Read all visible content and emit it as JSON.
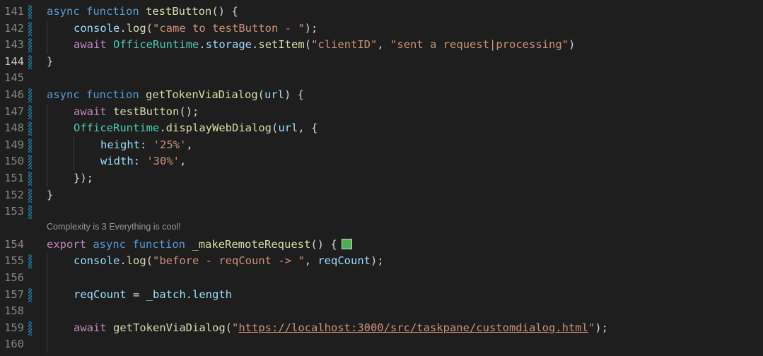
{
  "editor": {
    "code_lens": "Complexity is 3 Everything is cool!",
    "color_swatch": "#4caf50",
    "lines": [
      {
        "n": "141",
        "gm": true,
        "indent": 0,
        "tokens": [
          [
            "async",
            "kw"
          ],
          [
            " ",
            "pun"
          ],
          [
            "function",
            "kw"
          ],
          [
            " ",
            "pun"
          ],
          [
            "testButton",
            "fn"
          ],
          [
            "() {",
            "pun"
          ]
        ]
      },
      {
        "n": "142",
        "gm": true,
        "indent": 1,
        "tokens": [
          [
            "console",
            "var"
          ],
          [
            ".",
            "pun"
          ],
          [
            "log",
            "fn"
          ],
          [
            "(",
            "pun"
          ],
          [
            "\"came to testButton - \"",
            "str"
          ],
          [
            ");",
            "pun"
          ]
        ]
      },
      {
        "n": "143",
        "gm": true,
        "indent": 1,
        "tokens": [
          [
            "await",
            "ctl"
          ],
          [
            " ",
            "pun"
          ],
          [
            "OfficeRuntime",
            "cls"
          ],
          [
            ".",
            "pun"
          ],
          [
            "storage",
            "var"
          ],
          [
            ".",
            "pun"
          ],
          [
            "setItem",
            "fn"
          ],
          [
            "(",
            "pun"
          ],
          [
            "\"clientID\"",
            "str"
          ],
          [
            ", ",
            "pun"
          ],
          [
            "\"sent a request|processing\"",
            "str"
          ],
          [
            ")",
            "pun"
          ]
        ]
      },
      {
        "n": "144",
        "gm": true,
        "active": true,
        "indent": 0,
        "tokens": [
          [
            "}",
            "pun"
          ]
        ]
      },
      {
        "n": "145",
        "gm": false,
        "indent": 0,
        "tokens": []
      },
      {
        "n": "146",
        "gm": true,
        "indent": 0,
        "tokens": [
          [
            "async",
            "kw"
          ],
          [
            " ",
            "pun"
          ],
          [
            "function",
            "kw"
          ],
          [
            " ",
            "pun"
          ],
          [
            "getTokenViaDialog",
            "fn"
          ],
          [
            "(",
            "pun"
          ],
          [
            "url",
            "var"
          ],
          [
            ") {",
            "pun"
          ]
        ]
      },
      {
        "n": "147",
        "gm": true,
        "indent": 1,
        "tokens": [
          [
            "await",
            "ctl"
          ],
          [
            " ",
            "pun"
          ],
          [
            "testButton",
            "fn"
          ],
          [
            "();",
            "pun"
          ]
        ]
      },
      {
        "n": "148",
        "gm": true,
        "indent": 1,
        "tokens": [
          [
            "OfficeRuntime",
            "cls"
          ],
          [
            ".",
            "pun"
          ],
          [
            "displayWebDialog",
            "fn"
          ],
          [
            "(",
            "pun"
          ],
          [
            "url",
            "var"
          ],
          [
            ", {",
            "pun"
          ]
        ]
      },
      {
        "n": "149",
        "gm": true,
        "indent": 2,
        "tokens": [
          [
            "height",
            "prop"
          ],
          [
            ": ",
            "pun"
          ],
          [
            "'25%'",
            "str"
          ],
          [
            ",",
            "pun"
          ]
        ]
      },
      {
        "n": "150",
        "gm": true,
        "indent": 2,
        "tokens": [
          [
            "width",
            "prop"
          ],
          [
            ": ",
            "pun"
          ],
          [
            "'30%'",
            "str"
          ],
          [
            ",",
            "pun"
          ]
        ]
      },
      {
        "n": "151",
        "gm": true,
        "indent": 1,
        "tokens": [
          [
            "});",
            "pun"
          ]
        ]
      },
      {
        "n": "152",
        "gm": true,
        "indent": 0,
        "tokens": [
          [
            "}",
            "pun"
          ]
        ]
      },
      {
        "n": "153",
        "gm": true,
        "indent": 0,
        "tokens": []
      },
      {
        "n": "154",
        "gm": false,
        "indent": 0,
        "swatch": true,
        "tokens": [
          [
            "export",
            "ctl"
          ],
          [
            " ",
            "pun"
          ],
          [
            "async",
            "kw"
          ],
          [
            " ",
            "pun"
          ],
          [
            "function",
            "kw"
          ],
          [
            " ",
            "pun"
          ],
          [
            "_makeRemoteRequest",
            "fn"
          ],
          [
            "() {",
            "pun"
          ]
        ]
      },
      {
        "n": "155",
        "gm": true,
        "indent": 1,
        "tokens": [
          [
            "console",
            "var"
          ],
          [
            ".",
            "pun"
          ],
          [
            "log",
            "fn"
          ],
          [
            "(",
            "pun"
          ],
          [
            "\"before - reqCount -> \"",
            "str"
          ],
          [
            ", ",
            "pun"
          ],
          [
            "reqCount",
            "var"
          ],
          [
            ");",
            "pun"
          ]
        ]
      },
      {
        "n": "156",
        "gm": false,
        "indent": 1,
        "tokens": []
      },
      {
        "n": "157",
        "gm": true,
        "indent": 1,
        "tokens": [
          [
            "reqCount",
            "var"
          ],
          [
            " = ",
            "pun"
          ],
          [
            "_batch",
            "var"
          ],
          [
            ".",
            "pun"
          ],
          [
            "length",
            "var"
          ]
        ]
      },
      {
        "n": "158",
        "gm": false,
        "indent": 1,
        "tokens": []
      },
      {
        "n": "159",
        "gm": true,
        "indent": 1,
        "tokens": [
          [
            "await",
            "ctl"
          ],
          [
            " ",
            "pun"
          ],
          [
            "getTokenViaDialog",
            "fn"
          ],
          [
            "(",
            "pun"
          ],
          [
            "\"",
            "str"
          ],
          [
            "https://localhost:3000/src/taskpane/customdialog.html",
            "link"
          ],
          [
            "\"",
            "str"
          ],
          [
            ");",
            "pun"
          ]
        ]
      },
      {
        "n": "160",
        "gm": false,
        "indent": 1,
        "tokens": []
      }
    ]
  }
}
